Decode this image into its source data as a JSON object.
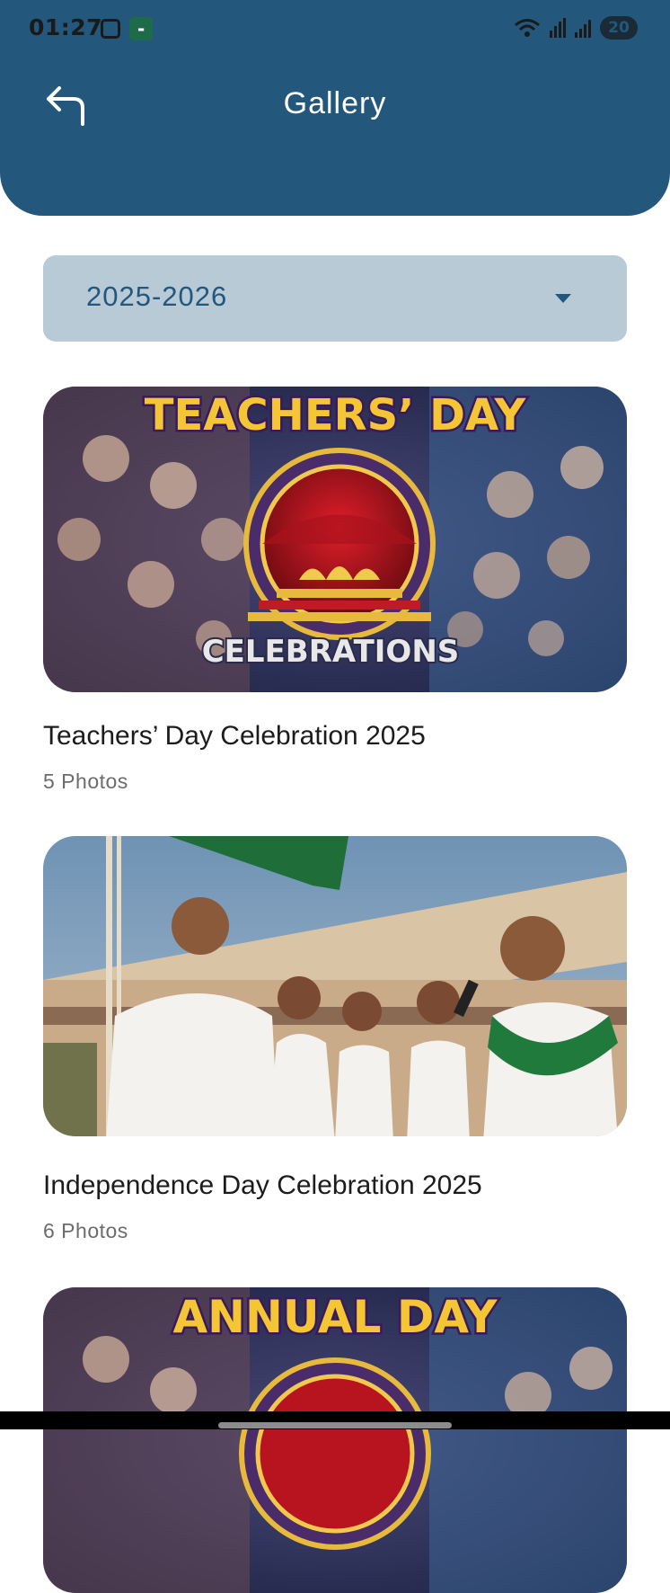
{
  "status_bar": {
    "time": "01:27",
    "battery": "20",
    "left_icons": [
      "screenshot-icon",
      "app-notification-icon"
    ],
    "right_icons": [
      "wifi-icon",
      "signal-icon",
      "signal-icon",
      "battery-icon"
    ]
  },
  "header": {
    "title": "Gallery",
    "back_icon": "back-arrow-icon",
    "background": "#23577c"
  },
  "year_select": {
    "value": "2025-2026",
    "background": "#b8cad6",
    "text_color": "#23577c"
  },
  "albums": [
    {
      "title": "Teachers’ Day Celebration 2025",
      "count": "5 Photos",
      "poster_heading": "TEACHERS’ DAY",
      "poster_footer": "CELEBRATIONS"
    },
    {
      "title": "Independence Day Celebration 2025",
      "count": "6 Photos"
    },
    {
      "title": "",
      "count": "",
      "poster_heading": "ANNUAL DAY"
    }
  ]
}
